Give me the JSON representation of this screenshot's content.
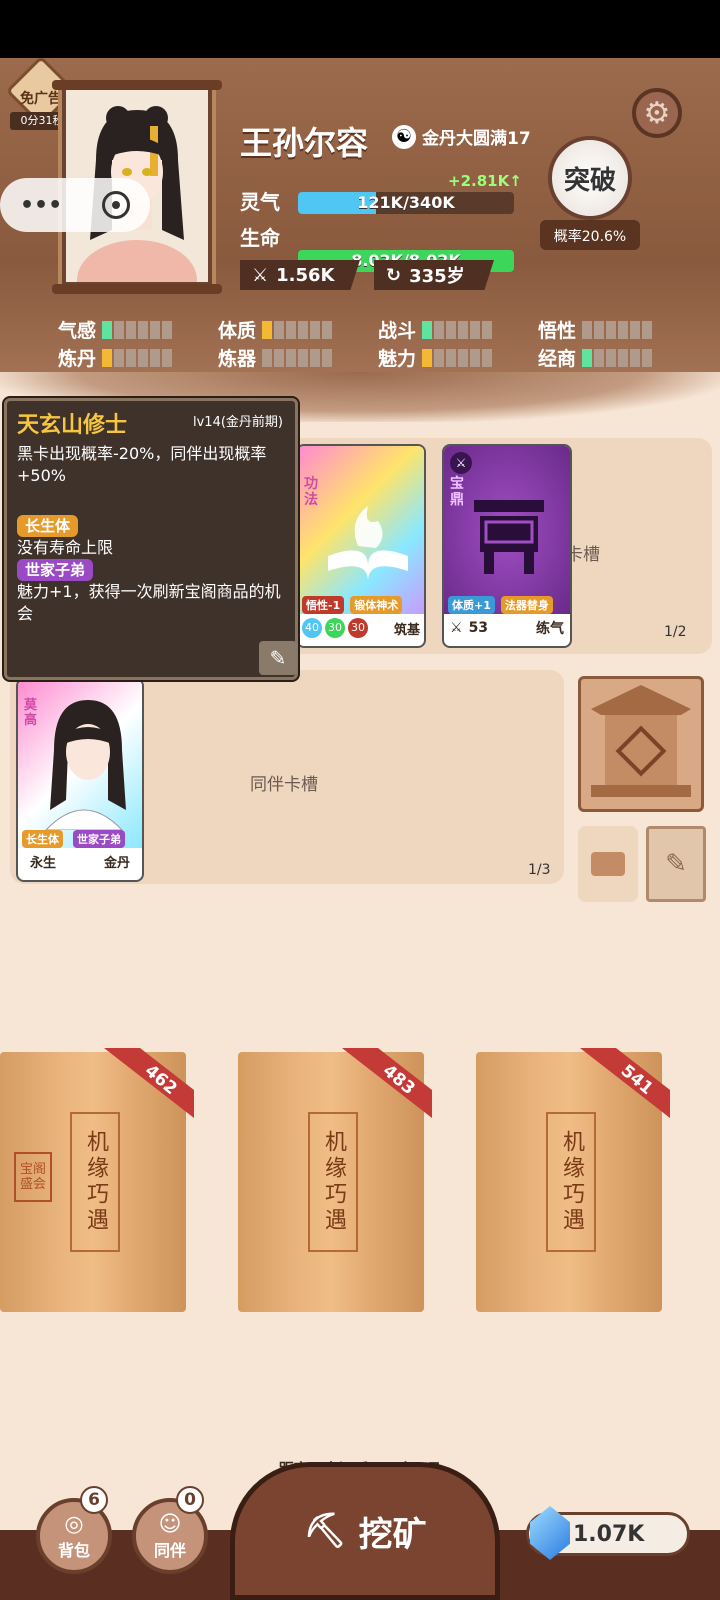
{
  "ad": {
    "label": "免广告",
    "timer": "0分31秒"
  },
  "player": {
    "name": "王孙尔容",
    "realm": "金丹大圆满17",
    "qi_label": "灵气",
    "qi_value": "121K/340K",
    "qi_gain": "+2.81K↑",
    "life_label": "生命",
    "life_value": "8.02K/8.02K",
    "power": "1.56K",
    "age": "335岁",
    "qi_fraction": 0.36,
    "life_fraction": 1.0
  },
  "breakthrough": {
    "label": "突破",
    "rate": "概率20.6%"
  },
  "attributes": [
    {
      "label": "气感",
      "level": 1,
      "color": "#5fe3a0"
    },
    {
      "label": "体质",
      "level": 1,
      "color": "#f3b935"
    },
    {
      "label": "战斗",
      "level": 1,
      "color": "#5fe3a0"
    },
    {
      "label": "悟性",
      "level": 0,
      "color": "#5fe3a0"
    },
    {
      "label": "炼丹",
      "level": 1,
      "color": "#f3b935"
    },
    {
      "label": "炼器",
      "level": 0,
      "color": "#5fe3a0"
    },
    {
      "label": "魅力",
      "level": 1,
      "color": "#f3b935"
    },
    {
      "label": "经商",
      "level": 1,
      "color": "#5fe3a0"
    }
  ],
  "tooltip": {
    "title": "天玄山修士",
    "level": "lv14(金丹前期)",
    "desc": "黑卡出现概率-20%，同伴出现概率+50%",
    "trait1": "长生体",
    "trait1_desc": "没有寿命上限",
    "trait2": "世家子弟",
    "trait2_desc": "魅力+1，获得一次刷新宝阁商品的机会"
  },
  "cards": {
    "gongfa": {
      "type": "功法",
      "tag1": "悟性-1",
      "tag2": "锻体神术",
      "n1": "40",
      "n2": "30",
      "n3": "30",
      "stage": "筑基"
    },
    "baoding": {
      "type": "宝鼎",
      "tag1": "体质+1",
      "tag2": "法器替身",
      "power": "53",
      "stage": "练气"
    },
    "slot1_count": "1/2",
    "slot1_label": "卡槽",
    "companion": {
      "name": "莫高",
      "tag1": "长生体",
      "tag2": "世家子弟",
      "life": "永生",
      "stage": "金丹"
    },
    "slot2_label": "同伴卡槽",
    "slot2_count": "1/3"
  },
  "packs": [
    {
      "price": "462",
      "title": "机缘巧遇",
      "seal": "宝阁盛会"
    },
    {
      "price": "483",
      "title": "机缘巧遇"
    },
    {
      "price": "541",
      "title": "机缘巧遇"
    }
  ],
  "sleep": "距离下次沉睡: 10年0月",
  "nav": {
    "bag": "背包",
    "bag_count": "6",
    "companion": "同伴",
    "companion_count": "0",
    "mine": "挖矿",
    "gems": "1.07K"
  }
}
